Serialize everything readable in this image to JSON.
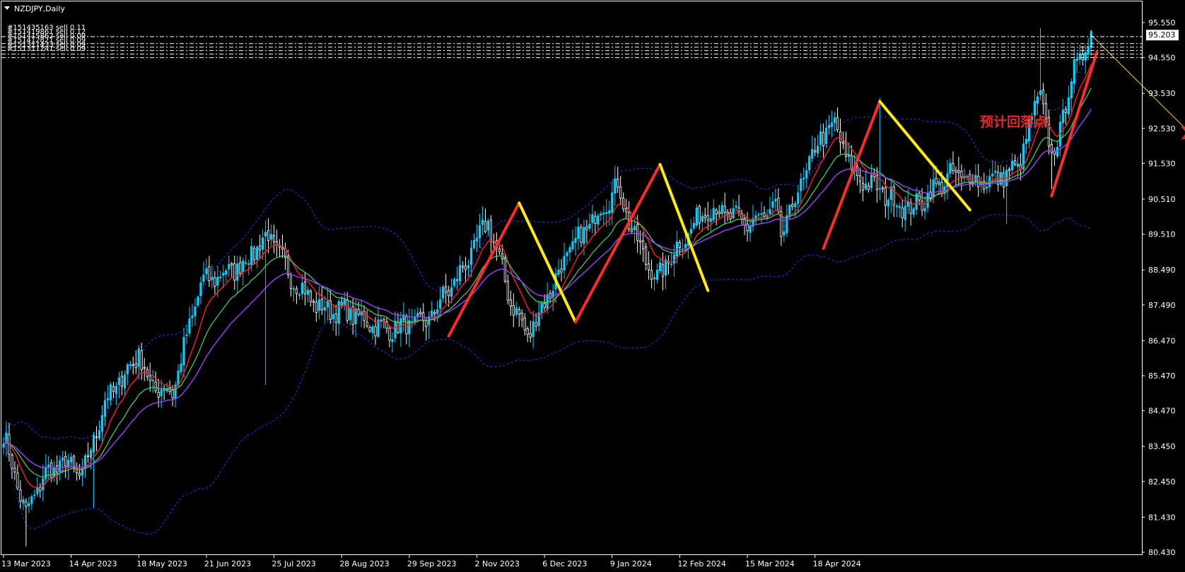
{
  "window": {
    "title": "NZDJPY,Daily"
  },
  "current_price": {
    "label": "95.203",
    "value": 95.203
  },
  "colors": {
    "background": "#000000",
    "frame": "#ffffff",
    "candle_up": "#00d3ff",
    "candle_down": "#ffffff",
    "ma_red": "#ff1f1f",
    "ma_green": "#3ddc6c",
    "ma_violet": "#a040ff",
    "band": "#1a3cff",
    "zigzag_up": "#ff2a2a",
    "zigzag_down": "#ffee00",
    "projection": "#ffd400",
    "annotation": "#e8282a"
  },
  "icons": {
    "title_arrow": "triangle-down-icon",
    "target_marker": "six-point-star-icon"
  },
  "annotation": {
    "text": "预计回落点"
  },
  "order_lines": [
    {
      "label": "#151435163 sell 0.11",
      "price": 95.15
    },
    {
      "label": "#151419861 sell 0.12",
      "price": 94.95
    },
    {
      "label": "#151415862 sell 0.09",
      "price": 94.85
    },
    {
      "label": "#151412821 sell 0.09",
      "price": 94.75
    },
    {
      "label": "#151311433 sell 0.09",
      "price": 94.65
    },
    {
      "label": "#151311241 sell 0.09",
      "price": 94.55
    }
  ],
  "chart_data": {
    "type": "candlestick",
    "symbol": "NZDJPY",
    "timeframe": "Daily",
    "ylim": [
      80.0,
      96.0
    ],
    "y_ticks": [
      "95.550",
      "94.550",
      "93.530",
      "92.530",
      "91.530",
      "90.510",
      "89.510",
      "88.490",
      "87.490",
      "86.470",
      "85.470",
      "84.470",
      "83.450",
      "82.450",
      "81.430",
      "80.430"
    ],
    "x_ticks": [
      "13 Mar 2023",
      "14 Apr 2023",
      "18 May 2023",
      "21 Jun 2023",
      "25 Jul 2023",
      "28 Aug 2023",
      "29 Sep 2023",
      "2 Nov 2023",
      "6 Dec 2023",
      "9 Jan 2024",
      "12 Feb 2024",
      "15 Mar 2024",
      "18 Apr 2024"
    ],
    "bars_per_x_tick": 24,
    "projected_bars": 45,
    "close_keypoints": [
      [
        0,
        83.8
      ],
      [
        8,
        81.5
      ],
      [
        14,
        82.6
      ],
      [
        22,
        83.0
      ],
      [
        28,
        82.6
      ],
      [
        36,
        84.7
      ],
      [
        48,
        86.1
      ],
      [
        52,
        85.2
      ],
      [
        60,
        85.0
      ],
      [
        70,
        88.1
      ],
      [
        84,
        88.6
      ],
      [
        94,
        89.5
      ],
      [
        102,
        88.3
      ],
      [
        112,
        87.4
      ],
      [
        122,
        87.3
      ],
      [
        135,
        86.8
      ],
      [
        150,
        87.0
      ],
      [
        163,
        88.5
      ],
      [
        172,
        89.9
      ],
      [
        180,
        87.6
      ],
      [
        186,
        86.6
      ],
      [
        200,
        88.9
      ],
      [
        218,
        90.9
      ],
      [
        224,
        89.4
      ],
      [
        232,
        88.2
      ],
      [
        236,
        88.8
      ],
      [
        250,
        90.3
      ],
      [
        264,
        89.8
      ],
      [
        274,
        90.2
      ],
      [
        276,
        89.5
      ],
      [
        290,
        92.3
      ],
      [
        295,
        92.6
      ],
      [
        302,
        91.2
      ],
      [
        322,
        90.2
      ],
      [
        336,
        91.2
      ],
      [
        350,
        91.0
      ],
      [
        360,
        91.4
      ],
      [
        368,
        93.6
      ],
      [
        372,
        91.6
      ],
      [
        380,
        94.2
      ],
      [
        386,
        95.2
      ]
    ],
    "zigzag": [
      {
        "kind": "up",
        "from": {
          "bar": 158,
          "price": 86.6
        },
        "to": {
          "bar": 183,
          "price": 90.4
        }
      },
      {
        "kind": "down",
        "from": {
          "bar": 183,
          "price": 90.4
        },
        "to": {
          "bar": 203,
          "price": 87.0
        }
      },
      {
        "kind": "up",
        "from": {
          "bar": 203,
          "price": 87.0
        },
        "to": {
          "bar": 233,
          "price": 91.5
        }
      },
      {
        "kind": "down",
        "from": {
          "bar": 233,
          "price": 91.5
        },
        "to": {
          "bar": 250,
          "price": 87.9
        }
      },
      {
        "kind": "up",
        "from": {
          "bar": 291,
          "price": 89.1
        },
        "to": {
          "bar": 311,
          "price": 93.3
        }
      },
      {
        "kind": "down",
        "from": {
          "bar": 311,
          "price": 93.3
        },
        "to": {
          "bar": 343,
          "price": 90.2
        }
      },
      {
        "kind": "up",
        "from": {
          "bar": 372,
          "price": 90.6
        },
        "to": {
          "bar": 388,
          "price": 94.7
        }
      }
    ],
    "projection": {
      "from": {
        "bar": 386,
        "price": 95.2
      },
      "to": {
        "bar": 426,
        "price": 92.0
      }
    },
    "target_marker": {
      "bar": 422,
      "price": 92.4
    },
    "indicators": [
      "moving average (red)",
      "moving average (green)",
      "moving average (violet)",
      "envelope bands (blue dotted)"
    ]
  }
}
